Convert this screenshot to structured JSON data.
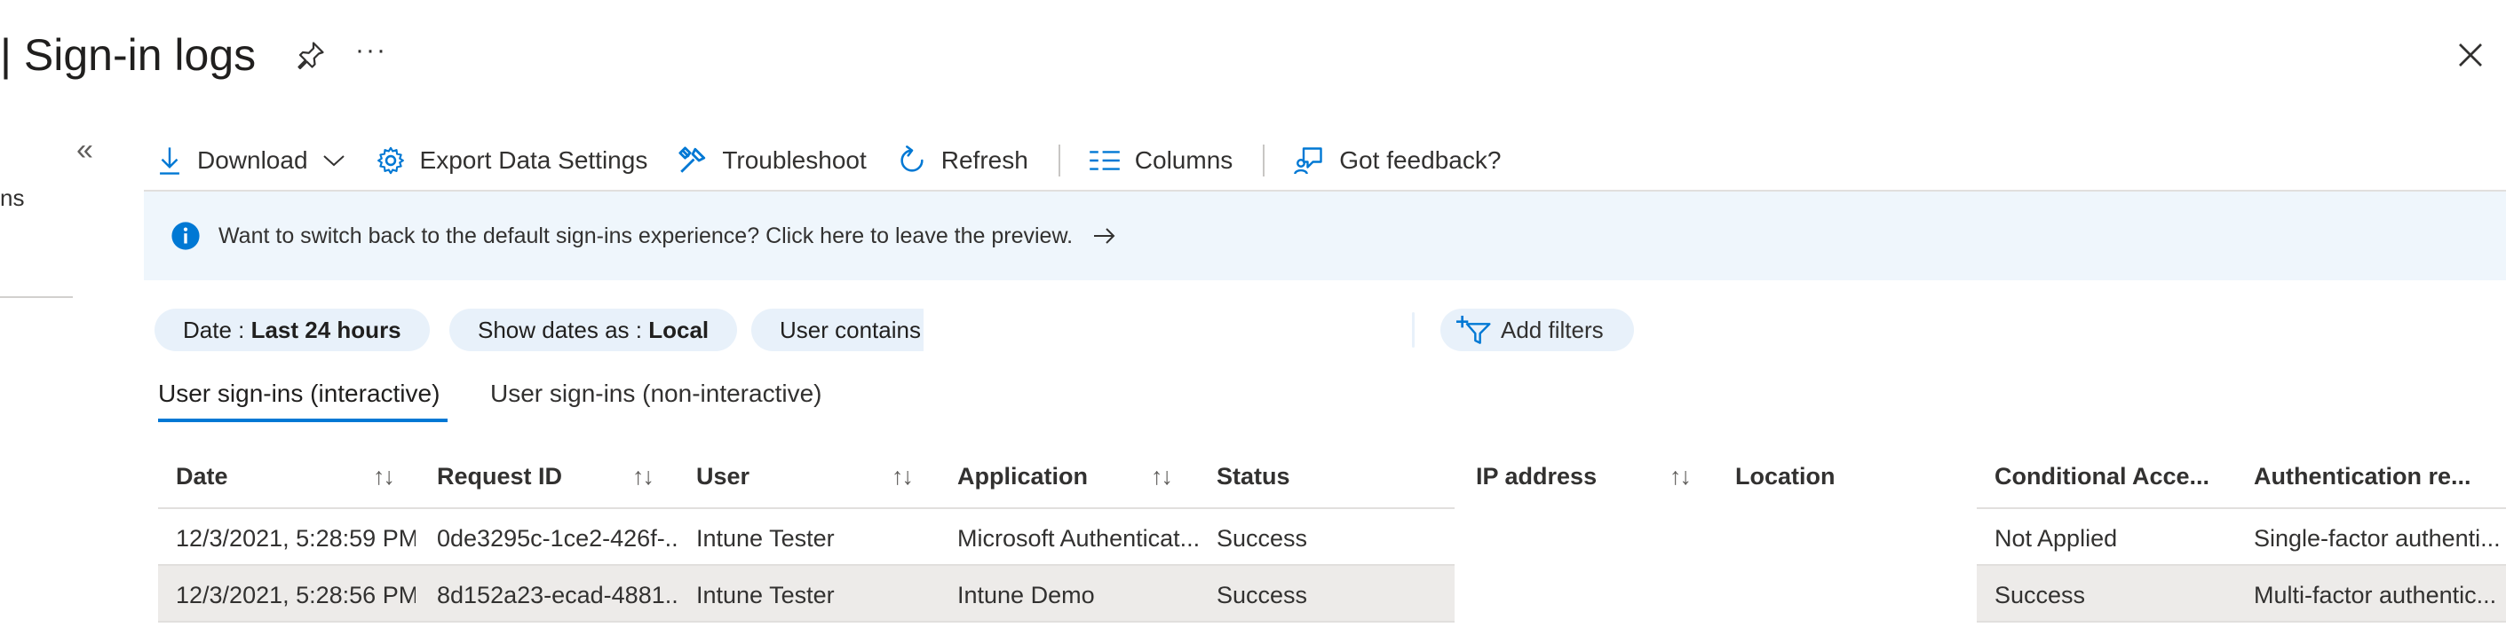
{
  "header": {
    "title": "| Sign-in logs",
    "more_label": "···"
  },
  "sidebar": {
    "collapse_label": "«",
    "partial_item": "ns"
  },
  "toolbar": {
    "download": "Download",
    "export": "Export Data Settings",
    "troubleshoot": "Troubleshoot",
    "refresh": "Refresh",
    "columns": "Columns",
    "feedback": "Got feedback?"
  },
  "banner": {
    "text": "Want to switch back to the default sign-ins experience? Click here to leave the preview."
  },
  "filters": {
    "date_label": "Date : ",
    "date_value": "Last 24 hours",
    "dates_as_label": "Show dates as : ",
    "dates_as_value": "Local",
    "user_label": "User contains",
    "add_filters": "Add filters"
  },
  "tabs": [
    {
      "label": "User sign-ins (interactive)",
      "active": true
    },
    {
      "label": "User sign-ins (non-interactive)",
      "active": false
    }
  ],
  "table": {
    "sort_glyph": "↑↓",
    "columns": [
      "Date",
      "Request ID",
      "User",
      "Application",
      "Status",
      "IP address",
      "Location",
      "Conditional Acce...",
      "Authentication re..."
    ],
    "rows": [
      [
        "12/3/2021, 5:28:59 PM",
        "0de3295c-1ce2-426f-...",
        "Intune Tester",
        "Microsoft Authenticat...",
        "Success",
        "",
        "",
        "Not Applied",
        "Single-factor authenti..."
      ],
      [
        "12/3/2021, 5:28:56 PM",
        "8d152a23-ecad-4881...",
        "Intune Tester",
        "Intune Demo",
        "Success",
        "",
        "",
        "Success",
        "Multi-factor authentic..."
      ]
    ]
  },
  "colors": {
    "accent": "#0078d4",
    "banner_bg": "#eff6fc",
    "pill_bg": "#e8f1fa",
    "selected_row_bg": "#edebe9"
  }
}
